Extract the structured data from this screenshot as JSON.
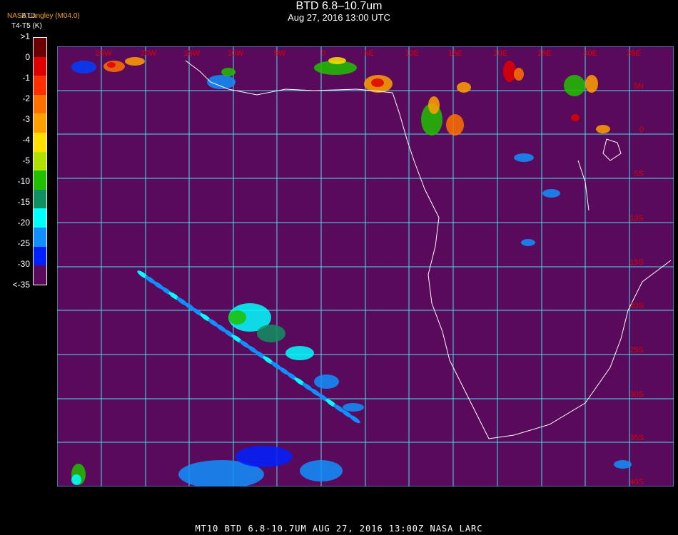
{
  "title": "BTD 6.8–10.7um",
  "subtitle": "Aug 27, 2016 13:00 UTC",
  "corner": {
    "line1": "NASA Langley (M04.0)",
    "line2": "BTD",
    "line3": "T4-T5 (K)"
  },
  "legend": {
    "ticks": [
      ">1",
      "0",
      "-1",
      "-2",
      "-3",
      "-4",
      "-5",
      "-10",
      "-15",
      "-20",
      "-25",
      "-30",
      "<-35"
    ],
    "colors": [
      "#6b0000",
      "#e00000",
      "#ff3000",
      "#ff7000",
      "#ffa000",
      "#ffe000",
      "#b0e000",
      "#20c000",
      "#109060",
      "#00ffff",
      "#1090ff",
      "#0020ff",
      "#5a0a5a"
    ]
  },
  "map": {
    "background": "#5a0a5a",
    "grid_color": "#40e0f0",
    "label_color": "#e00000",
    "lon_labels": [
      "25W",
      "20W",
      "15W",
      "10W",
      "5W",
      "0",
      "5E",
      "10E",
      "15E",
      "20E",
      "25E",
      "30E",
      "35E"
    ],
    "lat_labels": [
      "5N",
      "0",
      "5S",
      "10S",
      "15S",
      "20S",
      "25S",
      "30S",
      "35S",
      "40S"
    ]
  },
  "footer": "MT10   BTD 6.8-10.7UM    AUG 27, 2016 13:00Z    NASA LARC"
}
